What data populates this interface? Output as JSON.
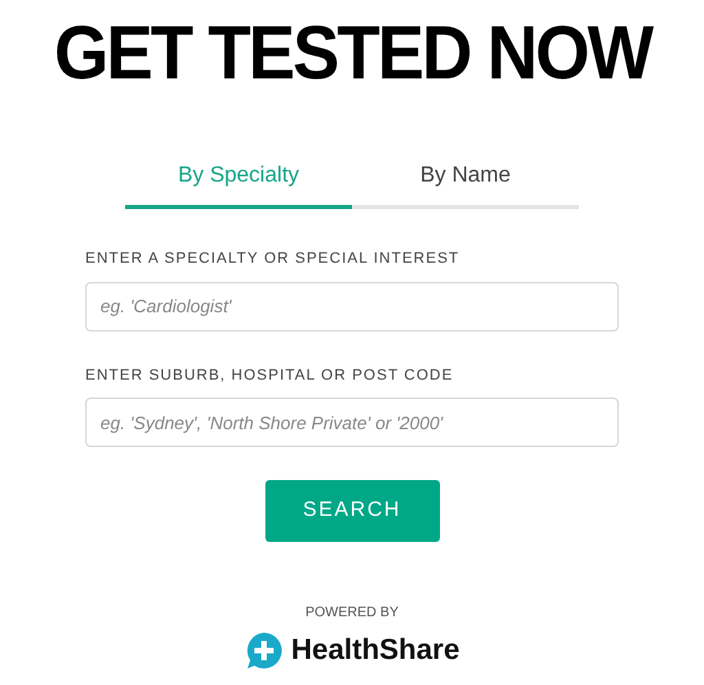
{
  "headline": "GET TESTED NOW",
  "tabs": [
    {
      "label": "By Specialty",
      "selected": true
    },
    {
      "label": "By Name",
      "selected": false
    }
  ],
  "fields": [
    {
      "label": "ENTER A SPECIALTY OR SPECIAL INTEREST",
      "placeholder": "eg. 'Cardiologist'"
    },
    {
      "label": "ENTER SUBURB, HOSPITAL OR POST CODE",
      "placeholder": "eg. 'Sydney', 'North Shore Private' or '2000'"
    }
  ],
  "search_button": "SEARCH",
  "footer": {
    "powered_by": "POWERED BY",
    "brand": "HealthShare"
  }
}
